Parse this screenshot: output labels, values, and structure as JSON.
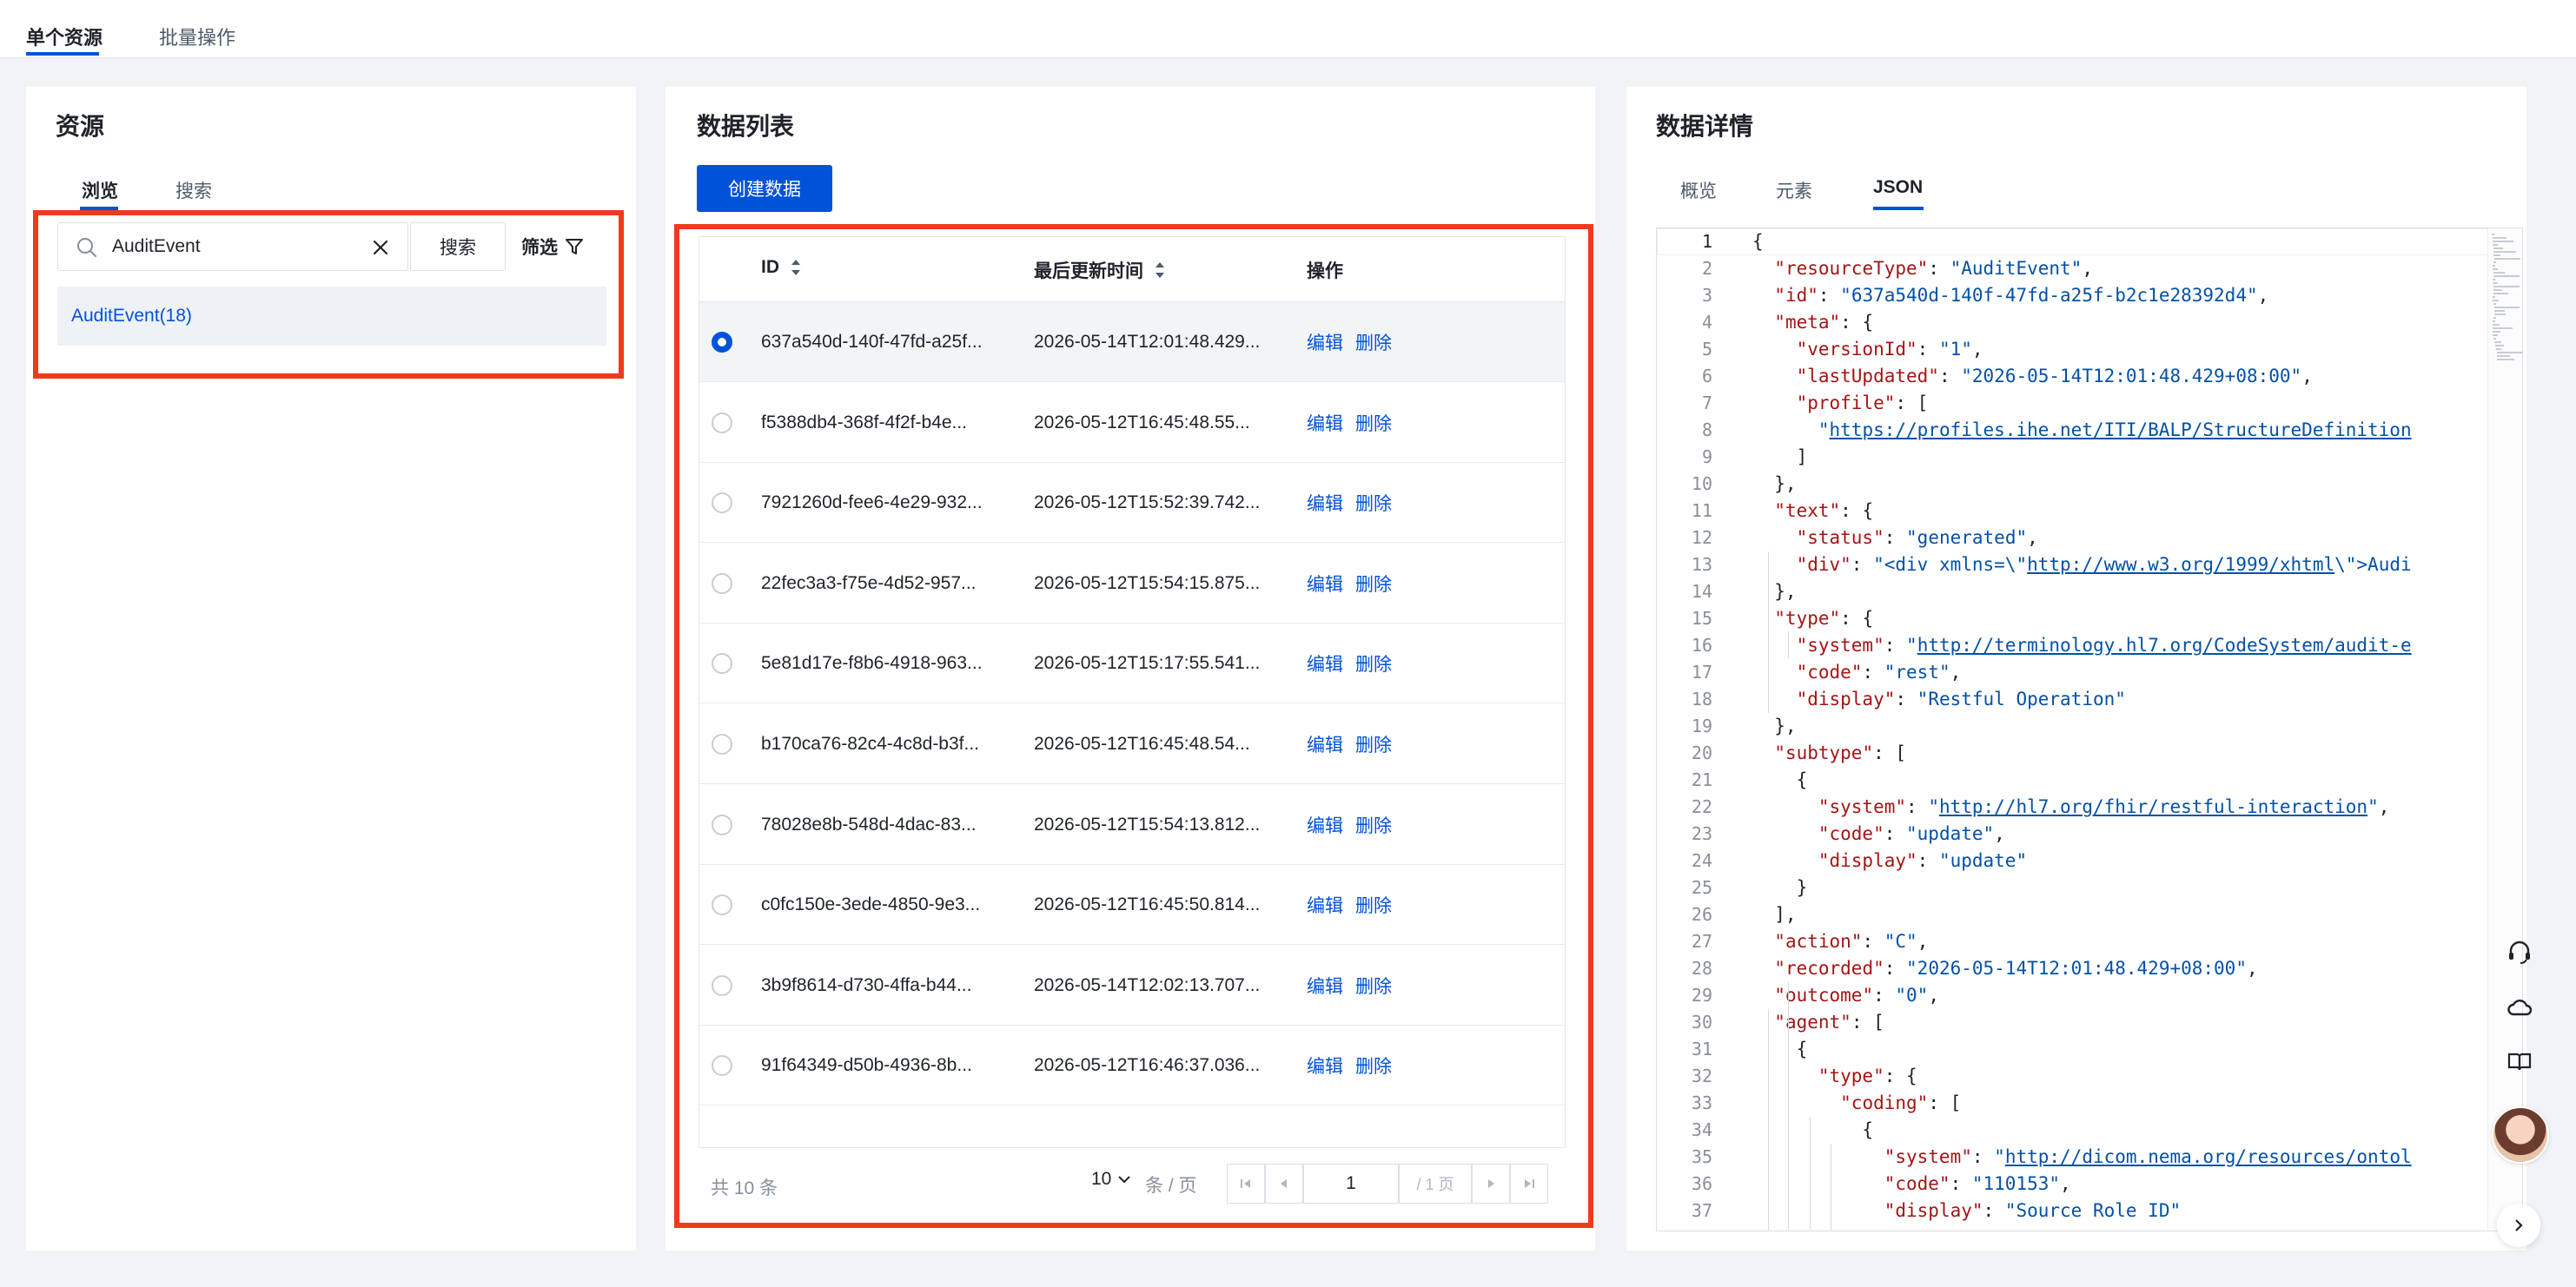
{
  "top_tabs": [
    {
      "label": "单个资源"
    },
    {
      "label": "批量操作"
    }
  ],
  "resource_panel": {
    "title": "资源",
    "tabs": [
      {
        "label": "浏览"
      },
      {
        "label": "搜索"
      }
    ],
    "search_value": "AuditEvent",
    "search_button": "搜索",
    "filter_label": "筛选",
    "items": [
      {
        "label": "AuditEvent(18)"
      }
    ]
  },
  "list_panel": {
    "title": "数据列表",
    "create_button": "创建数据",
    "columns": {
      "id": "ID",
      "updated": "最后更新时间",
      "actions": "操作"
    },
    "edit_label": "编辑",
    "delete_label": "删除",
    "rows": [
      {
        "id": "637a540d-140f-47fd-a25f...",
        "updated": "2026-05-14T12:01:48.429...",
        "selected": true
      },
      {
        "id": "f5388db4-368f-4f2f-b4e...",
        "updated": "2026-05-12T16:45:48.55...",
        "selected": false
      },
      {
        "id": "7921260d-fee6-4e29-932...",
        "updated": "2026-05-12T15:52:39.742...",
        "selected": false
      },
      {
        "id": "22fec3a3-f75e-4d52-957...",
        "updated": "2026-05-12T15:54:15.875...",
        "selected": false
      },
      {
        "id": "5e81d17e-f8b6-4918-963...",
        "updated": "2026-05-12T15:17:55.541...",
        "selected": false
      },
      {
        "id": "b170ca76-82c4-4c8d-b3f...",
        "updated": "2026-05-12T16:45:48.54...",
        "selected": false
      },
      {
        "id": "78028e8b-548d-4dac-83...",
        "updated": "2026-05-12T15:54:13.812...",
        "selected": false
      },
      {
        "id": "c0fc150e-3ede-4850-9e3...",
        "updated": "2026-05-12T16:45:50.814...",
        "selected": false
      },
      {
        "id": "3b9f8614-d730-4ffa-b44...",
        "updated": "2026-05-14T12:02:13.707...",
        "selected": false
      },
      {
        "id": "91f64349-d50b-4936-8b...",
        "updated": "2026-05-12T16:46:37.036...",
        "selected": false
      }
    ],
    "footer": {
      "total": "共 10 条",
      "page_size": "10",
      "page_size_unit": "条 / 页",
      "current_page": "1",
      "total_pages": "/ 1 页"
    }
  },
  "detail_panel": {
    "title": "数据详情",
    "tabs": [
      {
        "label": "概览"
      },
      {
        "label": "元素"
      },
      {
        "label": "JSON"
      }
    ],
    "active_tab": "JSON",
    "json_lines": [
      {
        "n": "1",
        "code": "{"
      },
      {
        "n": "2",
        "code": "  \"resourceType\": \"AuditEvent\","
      },
      {
        "n": "3",
        "code": "  \"id\": \"637a540d-140f-47fd-a25f-b2c1e28392d4\","
      },
      {
        "n": "4",
        "code": "  \"meta\": {"
      },
      {
        "n": "5",
        "code": "    \"versionId\": \"1\","
      },
      {
        "n": "6",
        "code": "    \"lastUpdated\": \"2026-05-14T12:01:48.429+08:00\","
      },
      {
        "n": "7",
        "code": "    \"profile\": ["
      },
      {
        "n": "8",
        "code": "      \"https://profiles.ihe.net/ITI/BALP/StructureDefinition"
      },
      {
        "n": "9",
        "code": "    ]"
      },
      {
        "n": "10",
        "code": "  },"
      },
      {
        "n": "11",
        "code": "  \"text\": {"
      },
      {
        "n": "12",
        "code": "    \"status\": \"generated\","
      },
      {
        "n": "13",
        "code": "    \"div\": \"<div xmlns=\\\"http://www.w3.org/1999/xhtml\\\">Audi"
      },
      {
        "n": "14",
        "code": "  },"
      },
      {
        "n": "15",
        "code": "  \"type\": {"
      },
      {
        "n": "16",
        "code": "    \"system\": \"http://terminology.hl7.org/CodeSystem/audit-e"
      },
      {
        "n": "17",
        "code": "    \"code\": \"rest\","
      },
      {
        "n": "18",
        "code": "    \"display\": \"Restful Operation\""
      },
      {
        "n": "19",
        "code": "  },"
      },
      {
        "n": "20",
        "code": "  \"subtype\": ["
      },
      {
        "n": "21",
        "code": "    {"
      },
      {
        "n": "22",
        "code": "      \"system\": \"http://hl7.org/fhir/restful-interaction\","
      },
      {
        "n": "23",
        "code": "      \"code\": \"update\","
      },
      {
        "n": "24",
        "code": "      \"display\": \"update\""
      },
      {
        "n": "25",
        "code": "    }"
      },
      {
        "n": "26",
        "code": "  ],"
      },
      {
        "n": "27",
        "code": "  \"action\": \"C\","
      },
      {
        "n": "28",
        "code": "  \"recorded\": \"2026-05-14T12:01:48.429+08:00\","
      },
      {
        "n": "29",
        "code": "  \"outcome\": \"0\","
      },
      {
        "n": "30",
        "code": "  \"agent\": ["
      },
      {
        "n": "31",
        "code": "    {"
      },
      {
        "n": "32",
        "code": "      \"type\": {"
      },
      {
        "n": "33",
        "code": "        \"coding\": ["
      },
      {
        "n": "34",
        "code": "          {"
      },
      {
        "n": "35",
        "code": "            \"system\": \"http://dicom.nema.org/resources/ontol"
      },
      {
        "n": "36",
        "code": "            \"code\": \"110153\","
      },
      {
        "n": "37",
        "code": "            \"display\": \"Source Role ID\""
      }
    ]
  },
  "colors": {
    "primary": "#0052d9",
    "highlight": "#ee3a1e",
    "json_key": "#a31515",
    "json_string": "#0451a5"
  },
  "side_tools": [
    "headset-icon",
    "cloud-icon",
    "book-icon",
    "avatar",
    "chevron-right-icon"
  ]
}
